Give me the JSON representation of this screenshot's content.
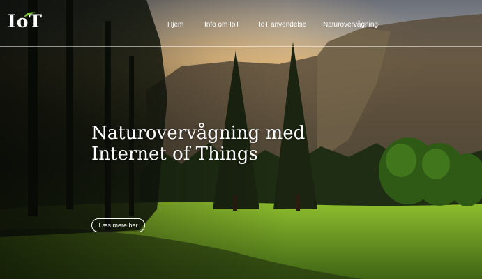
{
  "brand": {
    "logo_text": "IoT",
    "logo_icon": "sprout-leaf-icon"
  },
  "nav": {
    "items": [
      {
        "label": "Hjem"
      },
      {
        "label": "Info om IoT"
      },
      {
        "label": "IoT anvendelse"
      },
      {
        "label": "Naturovervågning"
      }
    ]
  },
  "hero": {
    "title_line1": "Naturovervågning med",
    "title_line2": "Internet of Things",
    "cta_label": "Læs mere her"
  },
  "colors": {
    "accent": "#ffffff",
    "nav_divider": "#d9d9d9"
  }
}
